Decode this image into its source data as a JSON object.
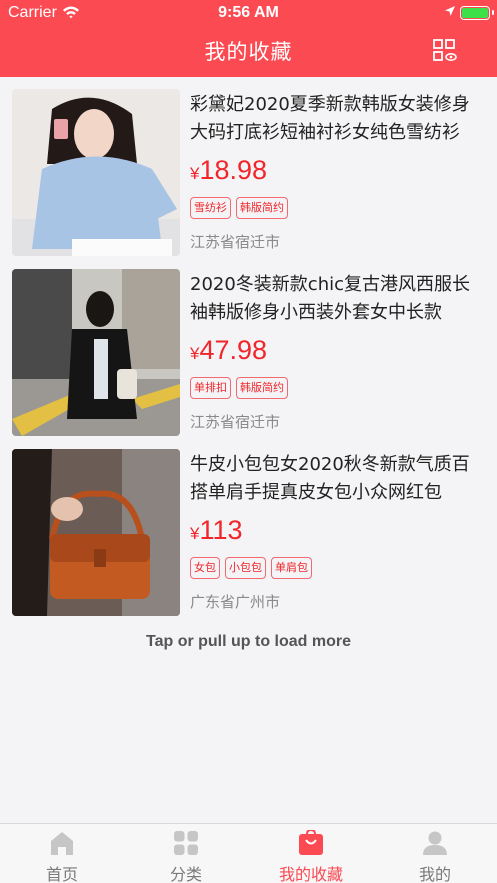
{
  "status_bar": {
    "carrier": "Carrier",
    "time": "9:56 AM"
  },
  "header": {
    "title": "我的收藏"
  },
  "products": [
    {
      "title": "彩黛妃2020夏季新款韩版女装修身大码打底衫短袖衬衫女纯色雪纺衫",
      "currency": "¥",
      "price": "18.98",
      "tags": [
        "雪纺衫",
        "韩版简约"
      ],
      "location": "江苏省宿迁市"
    },
    {
      "title": "2020冬装新款chic复古港风西服长袖韩版修身小西装外套女中长款",
      "currency": "¥",
      "price": "47.98",
      "tags": [
        "单排扣",
        "韩版简约"
      ],
      "location": "江苏省宿迁市"
    },
    {
      "title": "牛皮小包包女2020秋冬新款气质百搭单肩手提真皮女包小众网红包",
      "currency": "¥",
      "price": "113",
      "tags": [
        "女包",
        "小包包",
        "单肩包"
      ],
      "location": "广东省广州市"
    }
  ],
  "load_more": "Tap or pull up to load more",
  "tabbar": {
    "items": [
      {
        "label": "首页"
      },
      {
        "label": "分类"
      },
      {
        "label": "我的收藏"
      },
      {
        "label": "我的"
      }
    ]
  },
  "colors": {
    "brand": "#fb4a52",
    "price": "#f0262b",
    "tab_active": "#fb4a52",
    "tab_inactive": "#7a7a7a"
  },
  "icons": [
    "wifi-icon",
    "location-arrow-icon",
    "battery-icon",
    "grid-view-icon",
    "home-icon",
    "category-icon",
    "favorites-bag-icon",
    "profile-icon"
  ]
}
